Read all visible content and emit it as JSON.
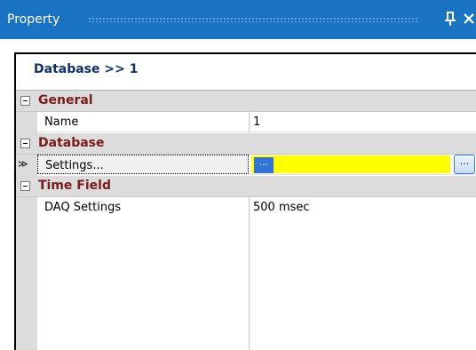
{
  "window": {
    "title": "Property",
    "pin_icon": "pin-icon",
    "close_icon": "close-icon"
  },
  "object_header": "Database >> 1",
  "grid": {
    "categories": [
      {
        "label": "General",
        "properties": [
          {
            "name": "Name",
            "value": "1"
          }
        ]
      },
      {
        "label": "Database",
        "properties": [
          {
            "name": "Settings...",
            "value": "...",
            "editor_button": "...",
            "selected": true
          }
        ]
      },
      {
        "label": "Time Field",
        "properties": [
          {
            "name": "DAQ Settings",
            "value": "500 msec"
          }
        ]
      }
    ],
    "selected_row_indicator": "≫"
  },
  "colors": {
    "titlebar": "#1a74c3",
    "header_text": "#10306e",
    "category_text": "#7b1a1a",
    "category_bg": "#dcdcdc",
    "edit_highlight": "#ffff00",
    "selection_blue": "#3173d9"
  }
}
